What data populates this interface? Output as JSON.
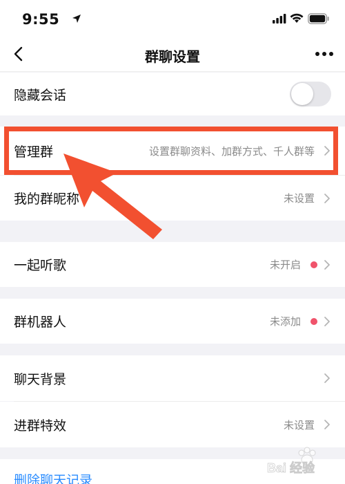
{
  "status_bar": {
    "time": "9:55"
  },
  "nav": {
    "title": "群聊设置"
  },
  "rows": {
    "hide_chat": {
      "label": "隐藏会话",
      "toggle_on": false
    },
    "manage_group": {
      "label": "管理群",
      "value": "设置群聊资料、加群方式、千人群等"
    },
    "my_nickname": {
      "label": "我的群昵称",
      "value": "未设置"
    },
    "listen_together": {
      "label": "一起听歌",
      "value": "未开启",
      "dot": true
    },
    "group_robot": {
      "label": "群机器人",
      "value": "未添加",
      "dot": true
    },
    "chat_background": {
      "label": "聊天背景"
    },
    "join_effect": {
      "label": "进群特效",
      "value": "未设置"
    }
  },
  "bottom_link": "删除聊天记录",
  "watermark": {
    "text": "Bai 经验"
  },
  "colors": {
    "highlight": "#f25030",
    "dot": "#f0536b",
    "link": "#2a8cff",
    "background": "#f2f2f6"
  }
}
